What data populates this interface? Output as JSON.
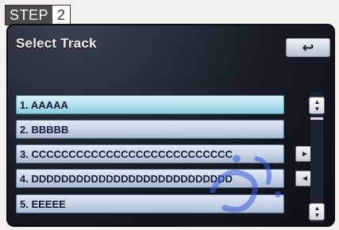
{
  "step": {
    "word": "STEP",
    "number": "2"
  },
  "screen": {
    "title": "Select Track",
    "back_icon": "↩",
    "tracks": [
      {
        "label": "1. AAAAA",
        "selected": true,
        "side_button": ""
      },
      {
        "label": "2. BBBBB",
        "selected": false,
        "side_button": ""
      },
      {
        "label": "3. CCCCCCCCCCCCCCCCCCCCCCCCCCC",
        "selected": false,
        "side_button": "►"
      },
      {
        "label": "4. DDDDDDDDDDDDDDDDDDDDDDDDDDD",
        "selected": false,
        "side_button": "◄"
      },
      {
        "label": "5. EEEEE",
        "selected": false,
        "side_button": ""
      }
    ],
    "scroll": {
      "up_icon": "▲▼",
      "down_icon": "▲▼"
    }
  },
  "colors": {
    "screen_bg": "#161b24",
    "row_bg": "#c3d1e6",
    "row_selected_bg": "#a7dce8",
    "row_text": "#121a33"
  }
}
